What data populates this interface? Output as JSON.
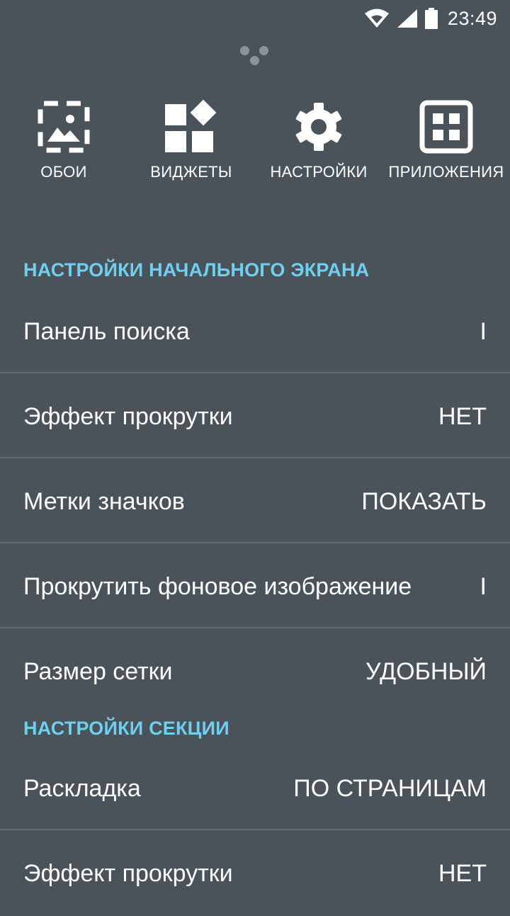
{
  "status_bar": {
    "time": "23:49",
    "icons": [
      "wifi-icon",
      "signal-icon",
      "battery-icon"
    ]
  },
  "quick_actions": [
    {
      "label": "ОБОИ",
      "icon": "wallpaper-icon"
    },
    {
      "label": "ВИДЖЕТЫ",
      "icon": "widgets-icon"
    },
    {
      "label": "НАСТРОЙКИ",
      "icon": "gear-icon"
    },
    {
      "label": "ПРИЛОЖЕНИЯ",
      "icon": "apps-grid-icon"
    }
  ],
  "home_section": {
    "title": "НАСТРОЙКИ НАЧАЛЬНОГО ЭКРАНА",
    "items": [
      {
        "label": "Панель поиска",
        "value": "I"
      },
      {
        "label": "Эффект прокрутки",
        "value": "НЕТ"
      },
      {
        "label": "Метки значков",
        "value": "ПОКАЗАТЬ"
      },
      {
        "label": "Прокрутить фоновое изображение",
        "value": "I"
      },
      {
        "label": "Размер сетки",
        "value": "УДОБНЫЙ"
      }
    ]
  },
  "drawer_section": {
    "title": "НАСТРОЙКИ СЕКЦИИ",
    "items": [
      {
        "label": "Раскладка",
        "value": "ПО СТРАНИЦАМ"
      },
      {
        "label": "Эффект прокрутки",
        "value": "НЕТ"
      }
    ]
  },
  "colors": {
    "background": "#4a535a",
    "accent": "#6fcfee",
    "divider": "#626a71",
    "text": "#ffffff"
  }
}
